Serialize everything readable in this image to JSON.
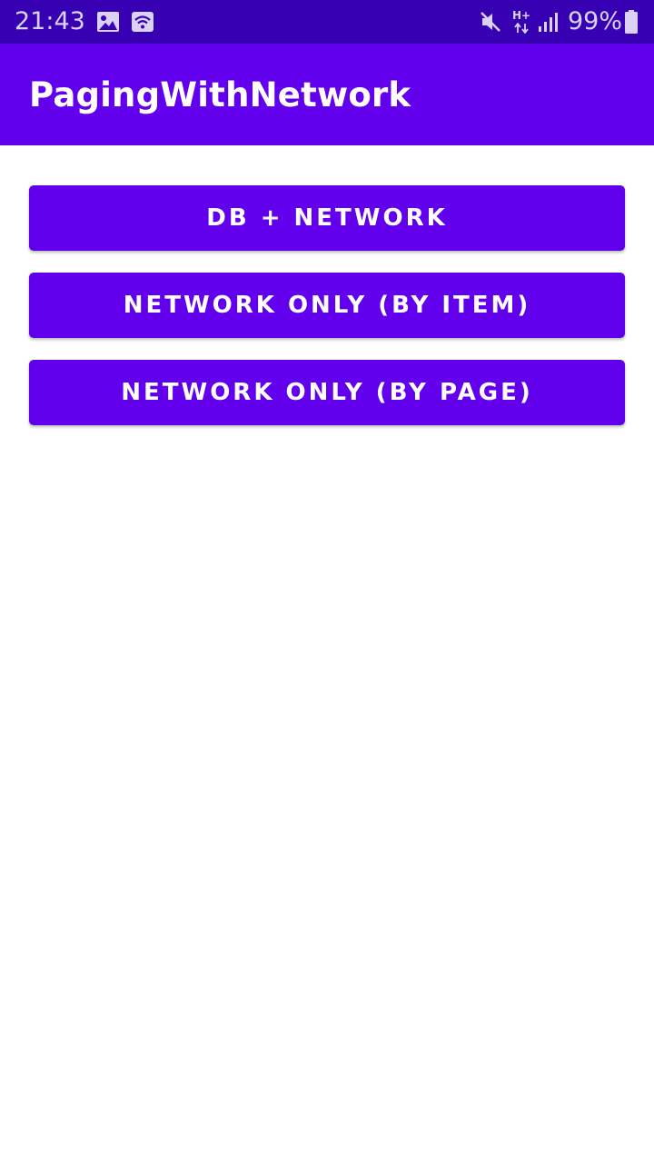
{
  "status_bar": {
    "time": "21:43",
    "battery_percent": "99%",
    "network_type": "H+",
    "icons": [
      "image-icon",
      "wifi-icon",
      "mute-icon",
      "network-type-icon",
      "signal-icon",
      "battery-icon"
    ],
    "background_color": "#3700b3"
  },
  "app_bar": {
    "title": "PagingWithNetwork",
    "background_color": "#6200ee"
  },
  "main": {
    "buttons": [
      {
        "label": "DB + NETWORK"
      },
      {
        "label": "NETWORK ONLY (BY ITEM)"
      },
      {
        "label": "NETWORK ONLY (BY PAGE)"
      }
    ],
    "button_color": "#6200ee"
  }
}
